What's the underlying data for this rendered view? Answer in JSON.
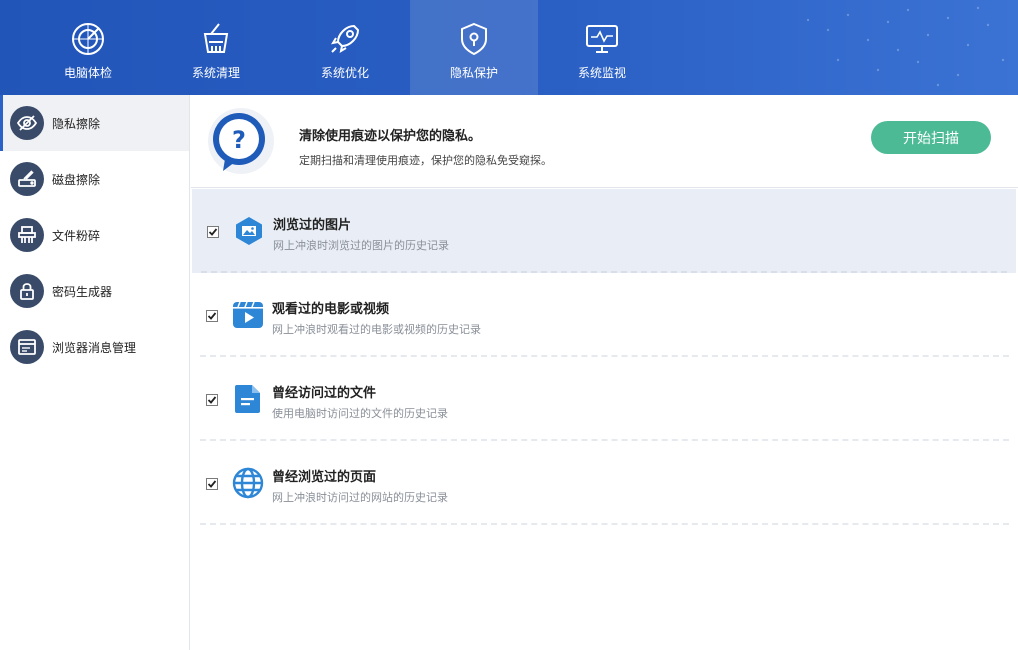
{
  "topnav": {
    "tabs": [
      {
        "label": "电脑体检",
        "icon": "radar-icon"
      },
      {
        "label": "系统清理",
        "icon": "broom-icon"
      },
      {
        "label": "系统优化",
        "icon": "rocket-icon"
      },
      {
        "label": "隐私保护",
        "icon": "shield-icon",
        "active": true
      },
      {
        "label": "系统监视",
        "icon": "monitor-icon"
      }
    ]
  },
  "sidebar": {
    "items": [
      {
        "label": "隐私擦除",
        "icon": "eye-slash-icon",
        "active": true
      },
      {
        "label": "磁盘擦除",
        "icon": "disk-eraser-icon"
      },
      {
        "label": "文件粉碎",
        "icon": "shredder-icon"
      },
      {
        "label": "密码生成器",
        "icon": "lock-icon"
      },
      {
        "label": "浏览器消息管理",
        "icon": "browser-icon"
      }
    ]
  },
  "banner": {
    "title": "清除使用痕迹以保护您的隐私。",
    "subtitle": "定期扫描和清理使用痕迹，保护您的隐私免受窥探。",
    "button_label": "开始扫描",
    "icon": "question-bubble-icon"
  },
  "items": [
    {
      "title": "浏览过的图片",
      "desc": "网上冲浪时浏览过的图片的历史记录",
      "checked": true,
      "icon": "image-icon"
    },
    {
      "title": "观看过的电影或视频",
      "desc": "网上冲浪时观看过的电影或视频的历史记录",
      "checked": true,
      "icon": "video-icon"
    },
    {
      "title": "曾经访问过的文件",
      "desc": "使用电脑时访问过的文件的历史记录",
      "checked": true,
      "icon": "document-icon"
    },
    {
      "title": "曾经浏览过的页面",
      "desc": "网上冲浪时访问过的网站的历史记录",
      "checked": true,
      "icon": "globe-icon"
    }
  ],
  "colors": {
    "nav_background": "#2a5fc4",
    "accent_button": "#4dba96",
    "item_icon": "#2e86d6",
    "sidebar_icon": "#3a4b6a"
  }
}
